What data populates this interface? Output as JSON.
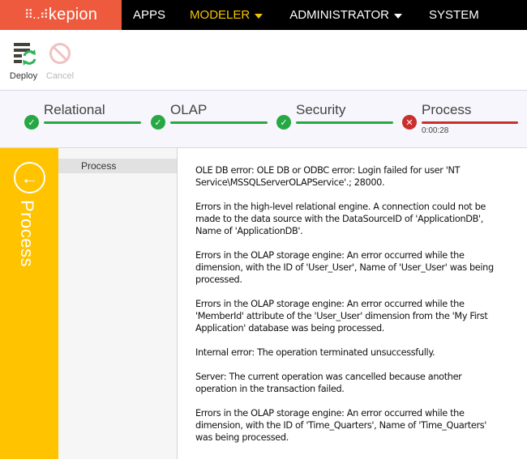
{
  "header": {
    "logo_text": "kepion",
    "logo_dots": "⠿‥⠾",
    "nav": [
      {
        "label": "APPS",
        "active": false,
        "dropdown": false
      },
      {
        "label": "MODELER",
        "active": true,
        "dropdown": true
      },
      {
        "label": "ADMINISTRATOR",
        "active": false,
        "dropdown": true
      },
      {
        "label": "SYSTEM",
        "active": false,
        "dropdown": false
      }
    ]
  },
  "toolbar": {
    "deploy_label": "Deploy",
    "cancel_label": "Cancel",
    "deploy_icon": "deploy-refresh-icon",
    "cancel_icon": "prohibited-icon"
  },
  "steps": [
    {
      "name": "Relational",
      "status": "success",
      "icon": "✓"
    },
    {
      "name": "OLAP",
      "status": "success",
      "icon": "✓"
    },
    {
      "name": "Security",
      "status": "success",
      "icon": "✓"
    },
    {
      "name": "Process",
      "status": "error",
      "icon": "✕",
      "elapsed": "0:00:28"
    }
  ],
  "sidebar": {
    "title": "Process",
    "back_icon": "←",
    "items": [
      {
        "label": "Process",
        "selected": true
      }
    ]
  },
  "messages": [
    "OLE DB error: OLE DB or ODBC error: Login failed for user 'NT Service\\MSSQLServerOLAPService'.; 28000.",
    "Errors in the high-level relational engine. A connection could not be made to the data source with the DataSourceID of 'ApplicationDB', Name of 'ApplicationDB'.",
    "Errors in the OLAP storage engine: An error occurred while the dimension, with the ID of 'User_User', Name of 'User_User' was being processed.",
    "Errors in the OLAP storage engine: An error occurred while the 'MemberId' attribute of the 'User_User' dimension from the 'My First Application' database was being processed.",
    "Internal error: The operation terminated unsuccessfully.",
    "Server: The current operation was cancelled because another operation in the transaction failed.",
    "Errors in the OLAP storage engine: An error occurred while the dimension, with the ID of 'Time_Quarters', Name of 'Time_Quarters' was being processed."
  ],
  "colors": {
    "brand": "#ee5a3e",
    "nav_active": "#f5c400",
    "success": "#27a844",
    "error": "#c9302c",
    "sidebar_accent": "#ffc300"
  }
}
